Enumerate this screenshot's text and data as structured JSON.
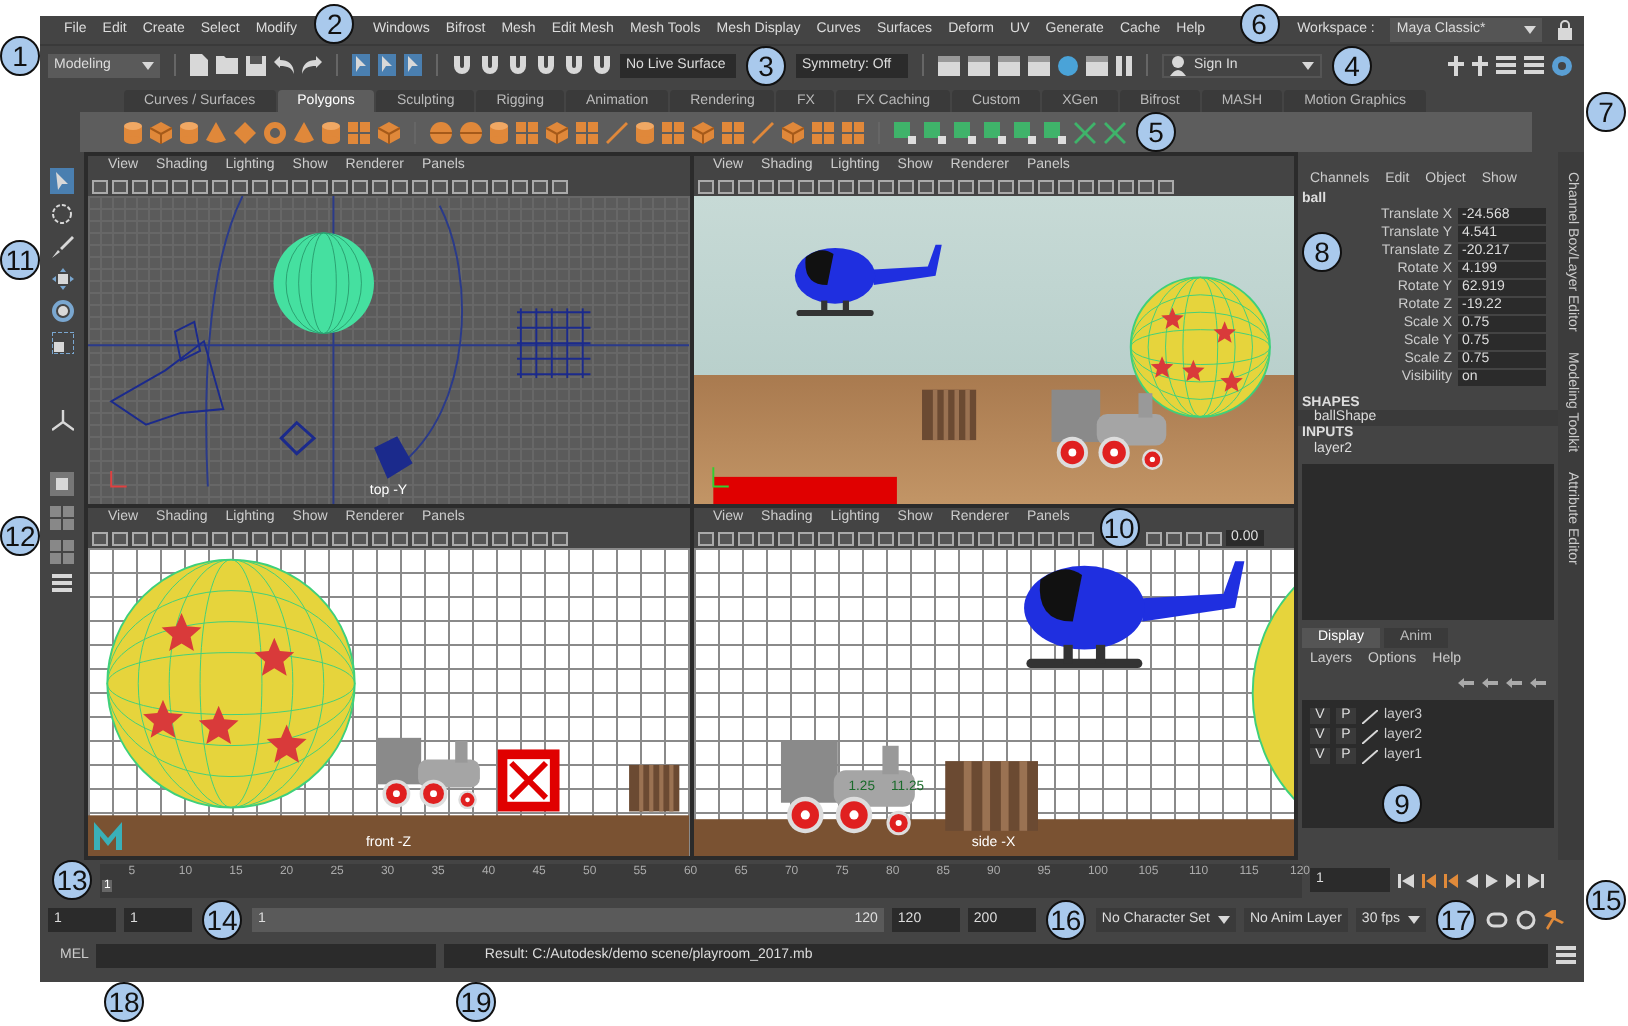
{
  "menu_bar": [
    "File",
    "Edit",
    "Create",
    "Select",
    "Modify",
    "Windows",
    "Bifrost",
    "Mesh",
    "Edit Mesh",
    "Mesh Tools",
    "Mesh Display",
    "Curves",
    "Surfaces",
    "Deform",
    "UV",
    "Generate",
    "Cache",
    "Help"
  ],
  "workspace": {
    "label": "Workspace :",
    "value": "Maya Classic*"
  },
  "status_line": {
    "menu_set": "Modeling",
    "live_surface": "No Live Surface",
    "symmetry": "Symmetry: Off",
    "sign_in": "Sign In"
  },
  "shelf_tabs": [
    {
      "label": "Curves / Surfaces",
      "selected": false
    },
    {
      "label": "Polygons",
      "selected": true
    },
    {
      "label": "Sculpting",
      "selected": false
    },
    {
      "label": "Rigging",
      "selected": false
    },
    {
      "label": "Animation",
      "selected": false
    },
    {
      "label": "Rendering",
      "selected": false
    },
    {
      "label": "FX",
      "selected": false
    },
    {
      "label": "FX Caching",
      "selected": false
    },
    {
      "label": "Custom",
      "selected": false
    },
    {
      "label": "XGen",
      "selected": false
    },
    {
      "label": "Bifrost",
      "selected": false
    },
    {
      "label": "MASH",
      "selected": false
    },
    {
      "label": "Motion Graphics",
      "selected": false
    }
  ],
  "viewports": [
    {
      "kind": "top",
      "menus": [
        "View",
        "Shading",
        "Lighting",
        "Show",
        "Renderer",
        "Panels"
      ],
      "camera_label": "top -Y"
    },
    {
      "kind": "persp",
      "menus": [
        "View",
        "Shading",
        "Lighting",
        "Show",
        "Renderer",
        "Panels"
      ]
    },
    {
      "kind": "front",
      "menus": [
        "View",
        "Shading",
        "Lighting",
        "Show",
        "Renderer",
        "Panels"
      ],
      "camera_label": "front -Z"
    },
    {
      "kind": "side",
      "menus": [
        "View",
        "Shading",
        "Lighting",
        "Show",
        "Renderer",
        "Panels"
      ],
      "camera_label": "side -X",
      "readout": "0.00",
      "annotations": [
        "1.25",
        "11.25"
      ]
    }
  ],
  "channel_box": {
    "menus": [
      "Channels",
      "Edit",
      "Object",
      "Show"
    ],
    "object": "ball",
    "channels": [
      {
        "name": "Translate X",
        "value": "-24.568"
      },
      {
        "name": "Translate Y",
        "value": "4.541"
      },
      {
        "name": "Translate Z",
        "value": "-20.217"
      },
      {
        "name": "Rotate X",
        "value": "4.199"
      },
      {
        "name": "Rotate Y",
        "value": "62.919"
      },
      {
        "name": "Rotate Z",
        "value": "-19.22"
      },
      {
        "name": "Scale X",
        "value": "0.75"
      },
      {
        "name": "Scale Y",
        "value": "0.75"
      },
      {
        "name": "Scale Z",
        "value": "0.75"
      },
      {
        "name": "Visibility",
        "value": "on"
      }
    ],
    "shapes_header": "SHAPES",
    "shapes": [
      "ballShape"
    ],
    "inputs_header": "INPUTS",
    "inputs": [
      "layer2"
    ]
  },
  "layer_editor": {
    "tabs": [
      {
        "label": "Display",
        "selected": true
      },
      {
        "label": "Anim",
        "selected": false
      }
    ],
    "menus": [
      "Layers",
      "Options",
      "Help"
    ],
    "layers": [
      {
        "visibility": "V",
        "playback": "P",
        "name": "layer3"
      },
      {
        "visibility": "V",
        "playback": "P",
        "name": "layer2"
      },
      {
        "visibility": "V",
        "playback": "P",
        "name": "layer1"
      }
    ]
  },
  "side_tabs": [
    "Channel Box/Layer Editor",
    "Modeling Toolkit",
    "Attribute Editor"
  ],
  "time_slider": {
    "current_marker": "1",
    "level": 0,
    "ticks": [
      "5",
      "10",
      "15",
      "20",
      "25",
      "30",
      "35",
      "40",
      "45",
      "50",
      "55",
      "60",
      "65",
      "70",
      "75",
      "80",
      "85",
      "90",
      "95",
      "100",
      "105",
      "110",
      "115",
      "120"
    ],
    "current_frame": "1"
  },
  "range_slider": {
    "level": 1,
    "start": "1",
    "playback_start": "1",
    "range_start": "1",
    "range_end": "120",
    "playback_end": "120",
    "end": "200",
    "character_set": "No Character Set",
    "anim_layer": "No Anim Layer",
    "fps": "30 fps"
  },
  "command_line": {
    "language": "MEL",
    "result": "Result: C:/Autodesk/demo scene/playroom_2017.mb"
  },
  "callouts": [
    "1",
    "2",
    "3",
    "4",
    "5",
    "6",
    "7",
    "8",
    "9",
    "10",
    "11",
    "12",
    "13",
    "14",
    "15",
    "16",
    "17",
    "18",
    "19"
  ]
}
